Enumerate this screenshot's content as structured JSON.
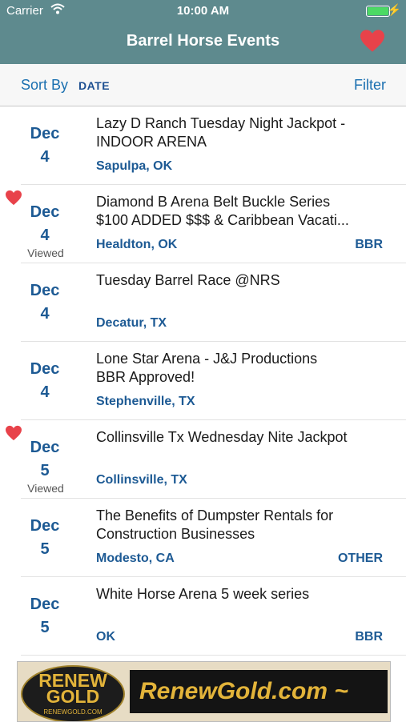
{
  "status_bar": {
    "carrier": "Carrier",
    "time": "10:00 AM"
  },
  "nav": {
    "title": "Barrel Horse Events",
    "favorites_icon": "heart-icon"
  },
  "sort_bar": {
    "sort_label": "Sort By",
    "sort_value": "DATE",
    "filter_label": "Filter"
  },
  "events": [
    {
      "month": "Dec",
      "day": "4",
      "favorited": false,
      "viewed": "",
      "title_lines": [
        "Lazy D Ranch Tuesday Night Jackpot -",
        "INDOOR ARENA"
      ],
      "location": "Sapulpa, OK",
      "tag": ""
    },
    {
      "month": "Dec",
      "day": "4",
      "favorited": true,
      "viewed": "Viewed",
      "title_lines": [
        "Diamond B Arena Belt Buckle Series",
        "$100 ADDED $$$ & Caribbean Vacati..."
      ],
      "location": "Healdton, OK",
      "tag": "BBR"
    },
    {
      "month": "Dec",
      "day": "4",
      "favorited": false,
      "viewed": "",
      "title_lines": [
        "Tuesday Barrel Race @NRS",
        ""
      ],
      "location": "Decatur, TX",
      "tag": ""
    },
    {
      "month": "Dec",
      "day": "4",
      "favorited": false,
      "viewed": "",
      "title_lines": [
        "Lone Star Arena - J&J Productions",
        "BBR Approved!"
      ],
      "location": "Stephenville, TX",
      "tag": ""
    },
    {
      "month": "Dec",
      "day": "5",
      "favorited": true,
      "viewed": "Viewed",
      "title_lines": [
        "Collinsville Tx Wednesday Nite Jackpot",
        ""
      ],
      "location": "Collinsville, TX",
      "tag": ""
    },
    {
      "month": "Dec",
      "day": "5",
      "favorited": false,
      "viewed": "",
      "title_lines": [
        "The Benefits of Dumpster Rentals for",
        "Construction Businesses"
      ],
      "location": "Modesto, CA",
      "tag": "OTHER"
    },
    {
      "month": "Dec",
      "day": "5",
      "favorited": false,
      "viewed": "",
      "title_lines": [
        "White Horse Arena 5 week series",
        ""
      ],
      "location": "OK",
      "tag": "BBR"
    }
  ],
  "ad": {
    "logo_line1": "RENEW",
    "logo_line2": "GOLD",
    "logo_small": "RENEWGOLD.COM",
    "banner_text": "RenewGold.com ~"
  },
  "colors": {
    "header": "#5e8a8e",
    "accent_blue": "#1d5a94",
    "heart": "#e8424a",
    "battery": "#4cd964"
  }
}
